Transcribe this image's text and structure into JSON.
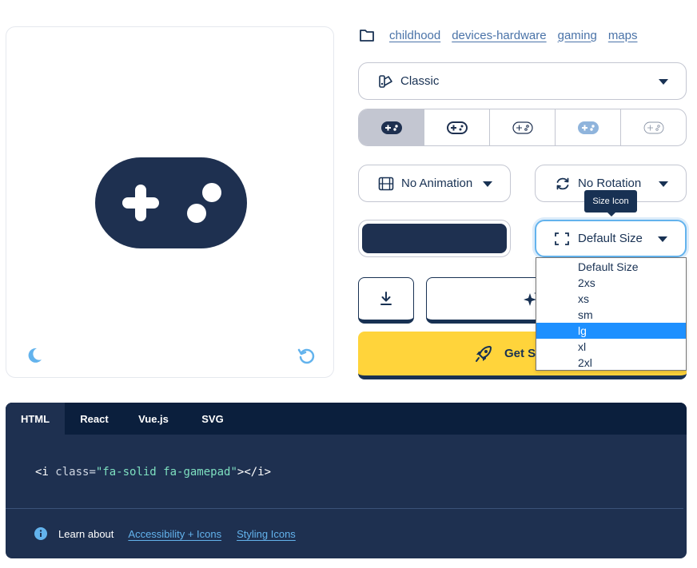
{
  "tags": [
    "childhood",
    "devices-hardware",
    "gaming",
    "maps"
  ],
  "style_select": {
    "value": "Classic"
  },
  "family_variants": [
    "solid",
    "regular",
    "light",
    "duotone",
    "thin"
  ],
  "animation_select": {
    "value": "No Animation"
  },
  "rotation_select": {
    "value": "No Rotation"
  },
  "tooltip": "Size Icon",
  "color": {
    "value": "#1e3050"
  },
  "size_select": {
    "value": "Default Size",
    "options": [
      "Default Size",
      "2xs",
      "xs",
      "sm",
      "lg",
      "xl",
      "2xl"
    ],
    "highlighted": "lg"
  },
  "get_button": {
    "label": "Get S"
  },
  "code": {
    "tabs": [
      "HTML",
      "React",
      "Vue.js",
      "SVG"
    ],
    "active_tab": "HTML",
    "open": "<i ",
    "attr": "class=",
    "string": "\"fa-solid fa-gamepad\"",
    "close": "></i>"
  },
  "learn": {
    "text": "Learn about",
    "links": [
      "Accessibility + Icons",
      "Styling Icons"
    ]
  },
  "colors": {
    "navy": "#183153",
    "yellow": "#ffd43b",
    "accent": "#63b3ed"
  }
}
